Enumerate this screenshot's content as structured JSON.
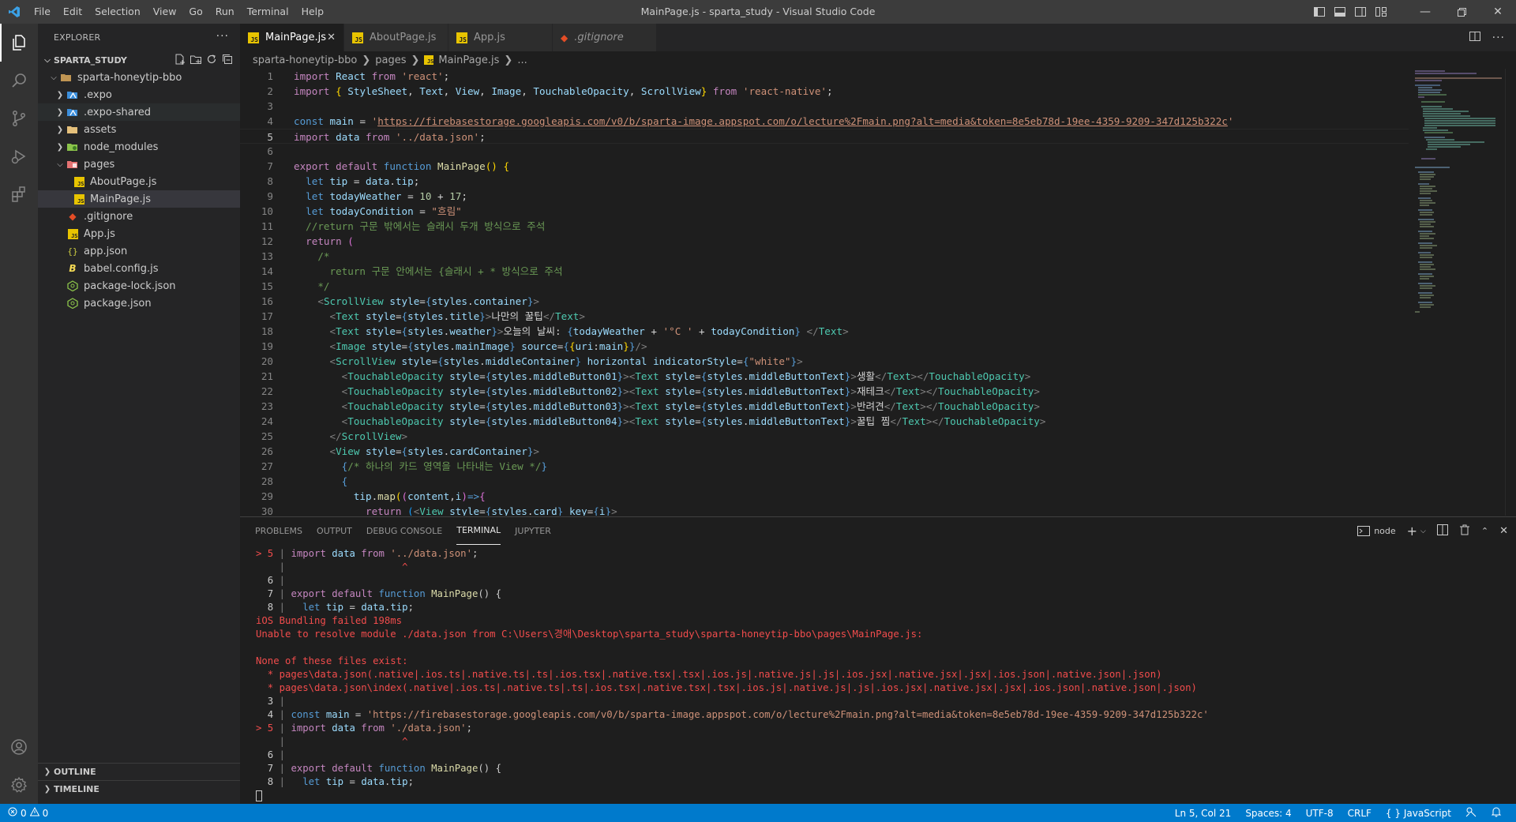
{
  "titlebar": {
    "menu": [
      "File",
      "Edit",
      "Selection",
      "View",
      "Go",
      "Run",
      "Terminal",
      "Help"
    ],
    "title": "MainPage.js - sparta_study - Visual Studio Code"
  },
  "sidebar": {
    "header": "EXPLORER",
    "header_more": "···",
    "root": "SPARTA_STUDY",
    "tree": [
      {
        "label": "sparta-honeytip-bbo",
        "depth": 1,
        "type": "folder-open"
      },
      {
        "label": ".expo",
        "depth": 2,
        "type": "folder-expo"
      },
      {
        "label": ".expo-shared",
        "depth": 2,
        "type": "folder-expo"
      },
      {
        "label": "assets",
        "depth": 2,
        "type": "folder"
      },
      {
        "label": "node_modules",
        "depth": 2,
        "type": "folder-node"
      },
      {
        "label": "pages",
        "depth": 2,
        "type": "folder-pages-open"
      },
      {
        "label": "AboutPage.js",
        "depth": 3,
        "type": "js"
      },
      {
        "label": "MainPage.js",
        "depth": 3,
        "type": "js"
      },
      {
        "label": ".gitignore",
        "depth": 2,
        "type": "git"
      },
      {
        "label": "App.js",
        "depth": 2,
        "type": "js"
      },
      {
        "label": "app.json",
        "depth": 2,
        "type": "json"
      },
      {
        "label": "babel.config.js",
        "depth": 2,
        "type": "babel"
      },
      {
        "label": "package-lock.json",
        "depth": 2,
        "type": "npm"
      },
      {
        "label": "package.json",
        "depth": 2,
        "type": "npm"
      }
    ],
    "outline": "OUTLINE",
    "timeline": "TIMELINE"
  },
  "tabs": [
    {
      "label": "MainPage.js",
      "active": true,
      "icon": "js"
    },
    {
      "label": "AboutPage.js",
      "active": false,
      "icon": "js"
    },
    {
      "label": "App.js",
      "active": false,
      "icon": "js"
    },
    {
      "label": ".gitignore",
      "active": false,
      "icon": "git"
    }
  ],
  "breadcrumb": [
    "sparta-honeytip-bbo",
    "pages",
    "MainPage.js",
    "..."
  ],
  "editor": {
    "line_numbers": [
      "1",
      "2",
      "3",
      "4",
      "5",
      "6",
      "7",
      "8",
      "9",
      "10",
      "11",
      "12",
      "13",
      "14",
      "15",
      "16",
      "17",
      "18",
      "19",
      "20",
      "21",
      "22",
      "23",
      "24",
      "25",
      "26",
      "27",
      "28",
      "29",
      "30"
    ],
    "current_line": 5
  },
  "panel": {
    "tabs": [
      "PROBLEMS",
      "OUTPUT",
      "DEBUG CONSOLE",
      "TERMINAL",
      "JUPYTER"
    ],
    "active_tab": "TERMINAL",
    "terminal_name": "node"
  },
  "status": {
    "errors": "0",
    "warnings": "0",
    "position": "Ln 5, Col 21",
    "spaces": "Spaces: 4",
    "encoding": "UTF-8",
    "eol": "CRLF",
    "language": "JavaScript",
    "language_prefix": "{ }"
  },
  "colors": {
    "statusbar": "#007acc",
    "titlebar": "#3c3c3c",
    "activitybar": "#333333",
    "sidebar": "#252526",
    "editor": "#1e1e1e"
  }
}
